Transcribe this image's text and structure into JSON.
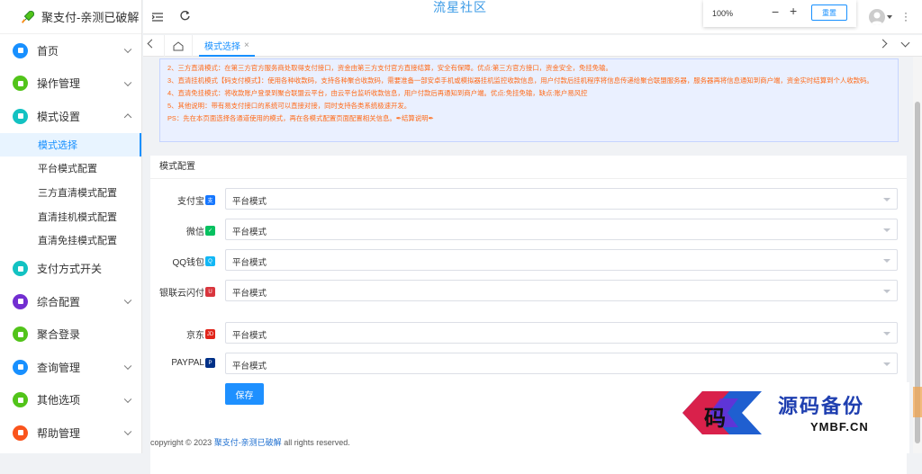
{
  "brand": {
    "title": "聚支付-亲测已破解"
  },
  "sidebar": {
    "items": [
      {
        "label": "首页",
        "icon": "home-icon",
        "color": "#1890ff",
        "arrow": "down"
      },
      {
        "label": "操作管理",
        "icon": "sliders-icon",
        "color": "#52c41a",
        "arrow": "down"
      },
      {
        "label": "模式设置",
        "icon": "grid-icon",
        "color": "#13c2c2",
        "arrow": "up"
      }
    ],
    "subitems": [
      "模式选择",
      "平台模式配置",
      "三方直清模式配置",
      "直清挂机模式配置",
      "直清免挂模式配置"
    ],
    "items2": [
      {
        "label": "支付方式开关",
        "icon": "toggle-icon",
        "color": "#13c2c2",
        "arrow": ""
      },
      {
        "label": "综合配置",
        "icon": "config-icon",
        "color": "#722ed1",
        "arrow": "down"
      },
      {
        "label": "聚合登录",
        "icon": "login-icon",
        "color": "#52c41a",
        "arrow": ""
      },
      {
        "label": "查询管理",
        "icon": "query-icon",
        "color": "#1890ff",
        "arrow": "down"
      },
      {
        "label": "其他选项",
        "icon": "options-icon",
        "color": "#52c41a",
        "arrow": "down"
      },
      {
        "label": "帮助管理",
        "icon": "help-icon",
        "color": "#fa541c",
        "arrow": "down"
      }
    ]
  },
  "topbar": {
    "site_title": "流星社区",
    "zoom": "100%",
    "zoom_minus": "−",
    "zoom_plus": "+",
    "reset": "重置"
  },
  "tabs": {
    "active": "模式选择",
    "close": "×"
  },
  "notice": [
    "2、三方直清模式：在第三方官方服务商处取得支付接口，资金由第三方支付官方直接结算，安全有保障。优点:第三方官方接口，资金安全，免挂免输。",
    "3、直清挂机模式【码支付模式】：使用各种收款码，支持各种聚合收款码，需要准备一部安卓手机或模拟器挂机监控收款信息，用户付款后挂机程序将信息传递给聚合联盟服务器，服务器再将信息通知到商户端，资金实时结算到个人收款码。",
    "4、直清免挂模式：将收款账户登录到聚合联盟云平台，由云平台监听收款信息，用户付款后再通知到商户端。优点:免挂免输，缺点:账户易风控",
    "5、其他说明：带有易支付接口的系统可以直接对接，同时支持各类系统极速开发。",
    "PS：先在本页面选择各通道使用的模式，再在各模式配置页面配置相关信息。✒结算说明✒"
  ],
  "config": {
    "title": "模式配置",
    "rows": [
      {
        "label": "支付宝",
        "badge": "支",
        "color": "#1677ff",
        "value": "平台模式"
      },
      {
        "label": "微信",
        "badge": "✓",
        "color": "#07c160",
        "value": "平台模式"
      },
      {
        "label": "QQ钱包",
        "badge": "Q",
        "color": "#12b7f5",
        "value": "平台模式"
      },
      {
        "label": "银联云闪付",
        "badge": "U",
        "color": "#d9363e",
        "value": "平台模式"
      },
      {
        "label": "京东",
        "badge": "JD",
        "color": "#e1251b",
        "value": "平台模式"
      },
      {
        "label": "PAYPAL",
        "badge": "P",
        "color": "#003087",
        "value": "平台模式"
      }
    ],
    "save": "保存"
  },
  "footer": {
    "prefix": "copyright © 2023 ",
    "link": "聚支付-亲测已破解",
    "suffix": " all rights reserved."
  },
  "watermark": {
    "text1": "源码备份",
    "text2": "YMBF.CN",
    "glyph": "码"
  }
}
